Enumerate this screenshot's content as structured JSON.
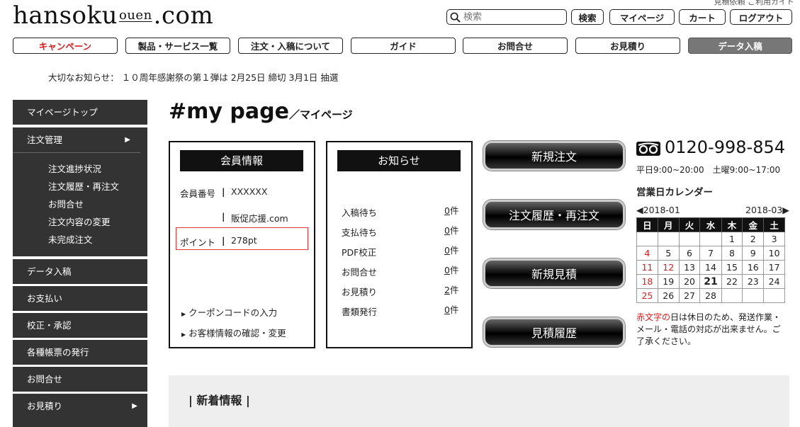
{
  "header": {
    "logo_left": "hansoku",
    "logo_mid": "ouen",
    "logo_right": ".com",
    "top_link": "見積依頼 ご利用ガイド",
    "search_placeholder": "検索",
    "search_button": "検索",
    "mypage_button": "マイページ",
    "cart_button": "カート",
    "logout_button": "ログアウト"
  },
  "nav": [
    "キャンペーン",
    "製品・サービス一覧",
    "注文・入稿について",
    "ガイド",
    "お問合せ",
    "お見積り",
    "データ入稿"
  ],
  "notice": "大切なお知らせ：  １０周年感謝祭の第１弾は 2月25日 締切 3月1日 抽選",
  "sidebar": {
    "top": "マイページトップ",
    "order": "注文管理",
    "order_sub": [
      "注文進捗状況",
      "注文履歴・再注文",
      "お問合せ",
      "注文内容の変更",
      "未完成注文"
    ],
    "items": [
      "データ入稿",
      "お支払い",
      "校正・承認",
      "各種帳票の発行",
      "お問合せ",
      "お見積り"
    ]
  },
  "title": {
    "main": "#my page",
    "sub": "／マイページ"
  },
  "member": {
    "heading": "会員情報",
    "id_label": "会員番号",
    "id_value": "XXXXXX",
    "company": "販促応援.com",
    "point_label": "ポイント",
    "point_value": "278pt",
    "coupon_link": "クーポンコードの入力",
    "info_link": "お客様情報の確認・変更"
  },
  "notices": {
    "heading": "お知らせ",
    "rows": [
      {
        "label": "入稿待ち",
        "count": "0",
        "unit": "件"
      },
      {
        "label": "支払待ち",
        "count": "0",
        "unit": "件"
      },
      {
        "label": "PDF校正",
        "count": "0",
        "unit": "件"
      },
      {
        "label": "お問合せ",
        "count": "0",
        "unit": "件"
      },
      {
        "label": "お見積り",
        "count": "2",
        "unit": "件"
      },
      {
        "label": "書類発行",
        "count": "0",
        "unit": "件"
      }
    ]
  },
  "actions": [
    "新規注文",
    "注文履歴・再注文",
    "新規見積",
    "見積履歴"
  ],
  "contact": {
    "phone": "0120-998-854",
    "hours": "平日9:00~20:00　土曜9:00~17:00"
  },
  "calendar": {
    "heading": "営業日カレンダー",
    "prev": "◀2018-01",
    "next": "2018-03▶",
    "weekdays": [
      "日",
      "月",
      "火",
      "水",
      "木",
      "金",
      "土"
    ],
    "weeks": [
      [
        "",
        "",
        "",
        "",
        "1",
        "2",
        "3"
      ],
      [
        "4",
        "5",
        "6",
        "7",
        "8",
        "9",
        "10"
      ],
      [
        "11",
        "12",
        "13",
        "14",
        "15",
        "16",
        "17"
      ],
      [
        "18",
        "19",
        "20",
        "21",
        "22",
        "23",
        "24"
      ],
      [
        "25",
        "26",
        "27",
        "28",
        "",
        "",
        ""
      ]
    ],
    "holidays": [
      "4",
      "11",
      "12",
      "18",
      "25"
    ],
    "today": "21",
    "note_red": "赤文字の",
    "note_rest": "日は休日のため、発送作業・メール・電話の対応が出来ません。ご了承ください。"
  },
  "news": {
    "heading": "新着情報"
  }
}
